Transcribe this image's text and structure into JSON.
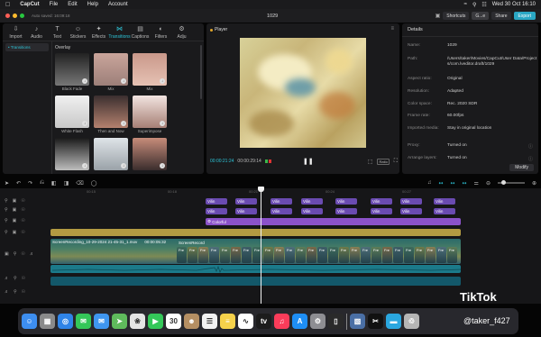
{
  "menubar": {
    "app_name": "CapCut",
    "items": [
      "File",
      "Edit",
      "Help",
      "Account"
    ],
    "datetime": "Wed 30 Oct 16:10"
  },
  "window": {
    "autosave": "Auto saved: 16:09:18",
    "project_title": "1029",
    "shortcuts_label": "Shortcuts",
    "account_label": "G...e",
    "share_label": "Share",
    "export_label": "Export"
  },
  "media": {
    "tabs": [
      {
        "label": "Import",
        "icon": "⇩"
      },
      {
        "label": "Audio",
        "icon": "♪"
      },
      {
        "label": "Text",
        "icon": "T"
      },
      {
        "label": "Stickers",
        "icon": "☺"
      },
      {
        "label": "Effects",
        "icon": "✦"
      },
      {
        "label": "Transitions",
        "icon": "⋈"
      },
      {
        "label": "Captions",
        "icon": "▤"
      },
      {
        "label": "Filters",
        "icon": "◐"
      },
      {
        "label": "Adju",
        "icon": "⚙"
      }
    ],
    "category": "• Transitions",
    "section_title": "Overlay",
    "thumbnails": [
      {
        "label": "Black Fade",
        "colors": [
          "#222",
          "#777"
        ]
      },
      {
        "label": "Mix",
        "colors": [
          "#caa59b",
          "#9c7f79"
        ]
      },
      {
        "label": "Mix",
        "colors": [
          "#c9988a",
          "#e6c2b4"
        ]
      },
      {
        "label": "White Flash",
        "colors": [
          "#f0f0f0",
          "#c8c8c8"
        ]
      },
      {
        "label": "Then and Now",
        "colors": [
          "#3b2f2f",
          "#b4816e"
        ]
      },
      {
        "label": "Superimpose",
        "colors": [
          "#f2e4e0",
          "#a67f75"
        ]
      },
      {
        "label": "",
        "colors": [
          "#1a1a1a",
          "#bdbdbd"
        ]
      },
      {
        "label": "",
        "colors": [
          "#dfe4e8",
          "#9aa2a8"
        ]
      },
      {
        "label": "",
        "colors": [
          "#c78c7a",
          "#3a2d2d"
        ]
      }
    ]
  },
  "player": {
    "label": "Player",
    "current_time": "00:00:21:24",
    "total_time": "00:00:29:14",
    "ratio_label": "Ratio"
  },
  "details": {
    "title": "Details",
    "rows": [
      {
        "k": "Name:",
        "v": "1029"
      },
      {
        "k": "Path:",
        "v": "/Users/taker/Movies/CapCut/User Data/Projects/com.lveditor.draft/1029"
      },
      {
        "k": "Aspect ratio:",
        "v": "Original"
      },
      {
        "k": "Resolution:",
        "v": "Adapted"
      },
      {
        "k": "Color space:",
        "v": "Rec. 2020 SDR"
      },
      {
        "k": "Frame rate:",
        "v": "60.00fps"
      },
      {
        "k": "Imported media:",
        "v": "Stay in original location"
      },
      {
        "k": "Proxy:",
        "v": "Turned on"
      },
      {
        "k": "Arrange layers:",
        "v": "Turned on"
      }
    ],
    "modify_label": "Modify"
  },
  "timeline": {
    "ruler": [
      "00:15",
      "00:18",
      "00:21",
      "00:24",
      "00:27"
    ],
    "filter_label": "Vilin",
    "colorful_label": "Colorful",
    "main_clip_label": "ScreenRecording_10-29-2024 21-45-31_1.mov",
    "main_clip_duration": "00:00:05:32",
    "second_clip_label": "ScreenRecord",
    "fre_label": "Fre"
  },
  "dock": {
    "apps": [
      {
        "name": "finder-icon",
        "color": "#3d8ef0",
        "glyph": "☺"
      },
      {
        "name": "launchpad-icon",
        "color": "#8a8a8a",
        "glyph": "▦"
      },
      {
        "name": "safari-icon",
        "color": "#2f84e8",
        "glyph": "◎"
      },
      {
        "name": "messages-icon",
        "color": "#34c759",
        "glyph": "✉"
      },
      {
        "name": "mail-icon",
        "color": "#3f96f0",
        "glyph": "✉"
      },
      {
        "name": "maps-icon",
        "color": "#5fbb5c",
        "glyph": "➤"
      },
      {
        "name": "photos-icon",
        "color": "#e4e4e4",
        "glyph": "❀"
      },
      {
        "name": "facetime-icon",
        "color": "#34c759",
        "glyph": "▶"
      },
      {
        "name": "calendar-icon",
        "color": "#ffffff",
        "glyph": "30"
      },
      {
        "name": "contacts-icon",
        "color": "#b58f63",
        "glyph": "☻"
      },
      {
        "name": "reminders-icon",
        "color": "#f2f2f2",
        "glyph": "☰"
      },
      {
        "name": "notes-icon",
        "color": "#f6d24b",
        "glyph": "≡"
      },
      {
        "name": "freeform-icon",
        "color": "#ffffff",
        "glyph": "∿"
      },
      {
        "name": "tv-icon",
        "color": "#1c1c1c",
        "glyph": "tv"
      },
      {
        "name": "music-icon",
        "color": "#fa3c5a",
        "glyph": "♫"
      },
      {
        "name": "appstore-icon",
        "color": "#1e8ef5",
        "glyph": "A"
      },
      {
        "name": "settings-icon",
        "color": "#8e8e93",
        "glyph": "⚙"
      },
      {
        "name": "iphone-mirroring-icon",
        "color": "#2a2a2a",
        "glyph": "▯"
      },
      {
        "name": "preview-icon",
        "color": "#4a6fa5",
        "glyph": "▧"
      },
      {
        "name": "capcut-icon",
        "color": "#111111",
        "glyph": "✂"
      },
      {
        "name": "folder-icon",
        "color": "#2aa7e0",
        "glyph": "▬"
      },
      {
        "name": "trash-icon",
        "color": "#b5b5b5",
        "glyph": "♲"
      }
    ]
  },
  "watermark": {
    "brand": "TikTok",
    "handle": "@taker_f427"
  }
}
